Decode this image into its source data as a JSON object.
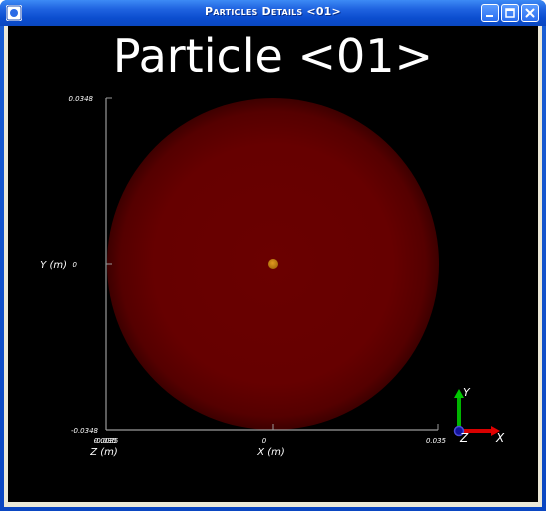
{
  "window": {
    "title": "Particles Details <01>",
    "min_label": "_",
    "max_label": "□",
    "close_label": "×"
  },
  "viewport": {
    "title": "Particle <01>",
    "y_axis": {
      "label": "Y (m)",
      "top_tick": "0.0348",
      "mid_tick": "0",
      "bottom_tick": "-0.0348"
    },
    "x_axis": {
      "label": "X (m)",
      "left_tick": "-0.035",
      "mid_tick": "0",
      "right_tick": "0.035"
    },
    "z_axis": {
      "label": "Z (m)",
      "tick": "0.0035"
    },
    "orientation": {
      "x": "X",
      "y": "Y",
      "z": "Z"
    },
    "colors": {
      "background": "#000000",
      "sphere": "#6e0000",
      "core": "#c87a10",
      "axis_x": "#e00000",
      "axis_y": "#00c000",
      "axis_z": "#1010a0"
    }
  }
}
